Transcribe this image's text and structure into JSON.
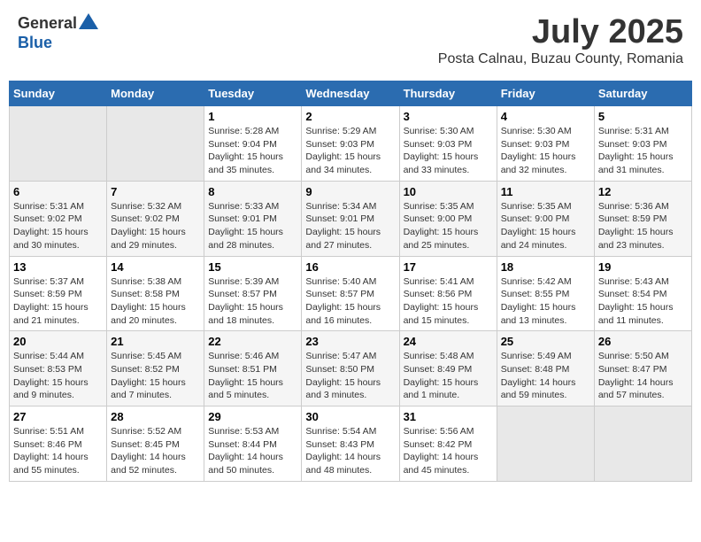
{
  "header": {
    "logo_general": "General",
    "logo_blue": "Blue",
    "month": "July 2025",
    "location": "Posta Calnau, Buzau County, Romania"
  },
  "days_of_week": [
    "Sunday",
    "Monday",
    "Tuesday",
    "Wednesday",
    "Thursday",
    "Friday",
    "Saturday"
  ],
  "weeks": [
    [
      {
        "day": "",
        "info": ""
      },
      {
        "day": "",
        "info": ""
      },
      {
        "day": "1",
        "sunrise": "5:28 AM",
        "sunset": "9:04 PM",
        "daylight": "15 hours and 35 minutes."
      },
      {
        "day": "2",
        "sunrise": "5:29 AM",
        "sunset": "9:03 PM",
        "daylight": "15 hours and 34 minutes."
      },
      {
        "day": "3",
        "sunrise": "5:30 AM",
        "sunset": "9:03 PM",
        "daylight": "15 hours and 33 minutes."
      },
      {
        "day": "4",
        "sunrise": "5:30 AM",
        "sunset": "9:03 PM",
        "daylight": "15 hours and 32 minutes."
      },
      {
        "day": "5",
        "sunrise": "5:31 AM",
        "sunset": "9:03 PM",
        "daylight": "15 hours and 31 minutes."
      }
    ],
    [
      {
        "day": "6",
        "sunrise": "5:31 AM",
        "sunset": "9:02 PM",
        "daylight": "15 hours and 30 minutes."
      },
      {
        "day": "7",
        "sunrise": "5:32 AM",
        "sunset": "9:02 PM",
        "daylight": "15 hours and 29 minutes."
      },
      {
        "day": "8",
        "sunrise": "5:33 AM",
        "sunset": "9:01 PM",
        "daylight": "15 hours and 28 minutes."
      },
      {
        "day": "9",
        "sunrise": "5:34 AM",
        "sunset": "9:01 PM",
        "daylight": "15 hours and 27 minutes."
      },
      {
        "day": "10",
        "sunrise": "5:35 AM",
        "sunset": "9:00 PM",
        "daylight": "15 hours and 25 minutes."
      },
      {
        "day": "11",
        "sunrise": "5:35 AM",
        "sunset": "9:00 PM",
        "daylight": "15 hours and 24 minutes."
      },
      {
        "day": "12",
        "sunrise": "5:36 AM",
        "sunset": "8:59 PM",
        "daylight": "15 hours and 23 minutes."
      }
    ],
    [
      {
        "day": "13",
        "sunrise": "5:37 AM",
        "sunset": "8:59 PM",
        "daylight": "15 hours and 21 minutes."
      },
      {
        "day": "14",
        "sunrise": "5:38 AM",
        "sunset": "8:58 PM",
        "daylight": "15 hours and 20 minutes."
      },
      {
        "day": "15",
        "sunrise": "5:39 AM",
        "sunset": "8:57 PM",
        "daylight": "15 hours and 18 minutes."
      },
      {
        "day": "16",
        "sunrise": "5:40 AM",
        "sunset": "8:57 PM",
        "daylight": "15 hours and 16 minutes."
      },
      {
        "day": "17",
        "sunrise": "5:41 AM",
        "sunset": "8:56 PM",
        "daylight": "15 hours and 15 minutes."
      },
      {
        "day": "18",
        "sunrise": "5:42 AM",
        "sunset": "8:55 PM",
        "daylight": "15 hours and 13 minutes."
      },
      {
        "day": "19",
        "sunrise": "5:43 AM",
        "sunset": "8:54 PM",
        "daylight": "15 hours and 11 minutes."
      }
    ],
    [
      {
        "day": "20",
        "sunrise": "5:44 AM",
        "sunset": "8:53 PM",
        "daylight": "15 hours and 9 minutes."
      },
      {
        "day": "21",
        "sunrise": "5:45 AM",
        "sunset": "8:52 PM",
        "daylight": "15 hours and 7 minutes."
      },
      {
        "day": "22",
        "sunrise": "5:46 AM",
        "sunset": "8:51 PM",
        "daylight": "15 hours and 5 minutes."
      },
      {
        "day": "23",
        "sunrise": "5:47 AM",
        "sunset": "8:50 PM",
        "daylight": "15 hours and 3 minutes."
      },
      {
        "day": "24",
        "sunrise": "5:48 AM",
        "sunset": "8:49 PM",
        "daylight": "15 hours and 1 minute."
      },
      {
        "day": "25",
        "sunrise": "5:49 AM",
        "sunset": "8:48 PM",
        "daylight": "14 hours and 59 minutes."
      },
      {
        "day": "26",
        "sunrise": "5:50 AM",
        "sunset": "8:47 PM",
        "daylight": "14 hours and 57 minutes."
      }
    ],
    [
      {
        "day": "27",
        "sunrise": "5:51 AM",
        "sunset": "8:46 PM",
        "daylight": "14 hours and 55 minutes."
      },
      {
        "day": "28",
        "sunrise": "5:52 AM",
        "sunset": "8:45 PM",
        "daylight": "14 hours and 52 minutes."
      },
      {
        "day": "29",
        "sunrise": "5:53 AM",
        "sunset": "8:44 PM",
        "daylight": "14 hours and 50 minutes."
      },
      {
        "day": "30",
        "sunrise": "5:54 AM",
        "sunset": "8:43 PM",
        "daylight": "14 hours and 48 minutes."
      },
      {
        "day": "31",
        "sunrise": "5:56 AM",
        "sunset": "8:42 PM",
        "daylight": "14 hours and 45 minutes."
      },
      {
        "day": "",
        "info": ""
      },
      {
        "day": "",
        "info": ""
      }
    ]
  ],
  "labels": {
    "sunrise": "Sunrise:",
    "sunset": "Sunset:",
    "daylight": "Daylight:"
  }
}
